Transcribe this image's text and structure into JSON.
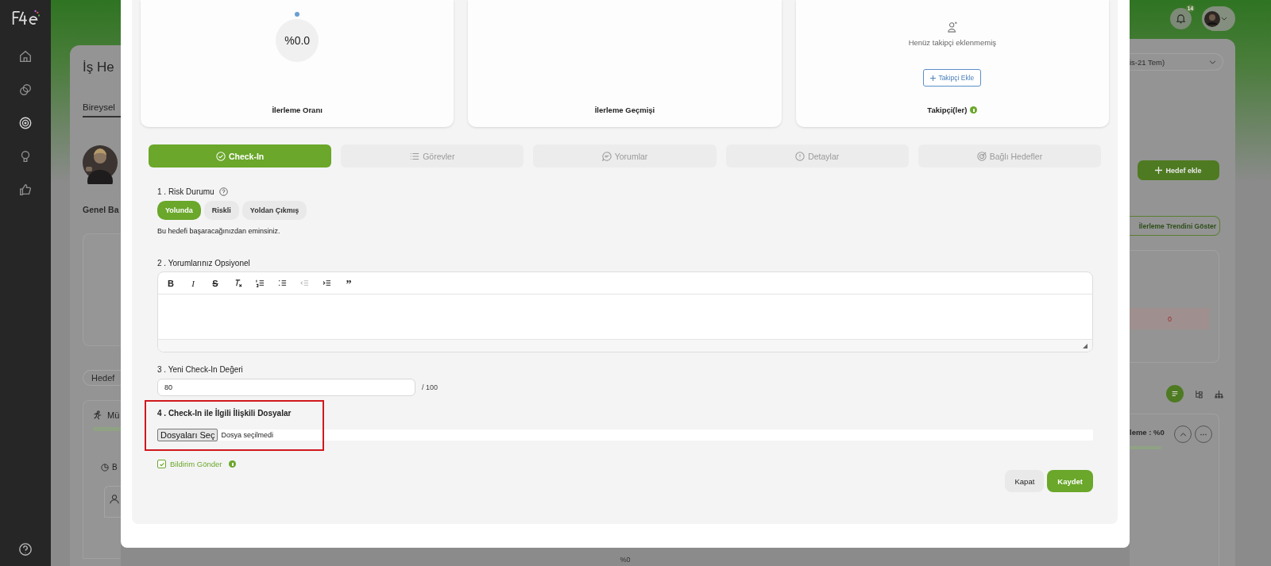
{
  "sidebar": {
    "items": [
      {
        "kind": "home",
        "selected": false
      },
      {
        "kind": "chat",
        "selected": false
      },
      {
        "kind": "target",
        "selected": true
      },
      {
        "kind": "bulb",
        "selected": false
      },
      {
        "kind": "thumb",
        "selected": false
      }
    ]
  },
  "header": {
    "notification_badge": "14"
  },
  "background_page": {
    "title": "İş He",
    "tab": "Bireysel",
    "section": "Genel Ba",
    "filter_chip": "Hedef",
    "goal_title": "Mü",
    "sub_label": "B",
    "date_range": "is-21 Tem)",
    "add_button": "Hedef ekle",
    "trend_button": "İlerleme Trendini Göster",
    "cell_value": "0",
    "goal_progress": "leme : %0",
    "footer_value": "%0"
  },
  "modal": {
    "cards": [
      {
        "kind": "progress",
        "value": "%0.0",
        "label": "İlerleme Oranı"
      },
      {
        "kind": "history",
        "label": "İlerleme Geçmişi"
      },
      {
        "kind": "followers",
        "empty_text": "Henüz takipçi eklenmemiş",
        "button": "Takipçi Ekle",
        "label": "Takipçi(ler)"
      }
    ],
    "tabs": [
      {
        "kind": "check",
        "label": "Check-In",
        "selected": true
      },
      {
        "kind": "list",
        "label": "Görevler",
        "selected": false
      },
      {
        "kind": "comment",
        "label": "Yorumlar",
        "selected": false
      },
      {
        "kind": "info",
        "label": "Detaylar",
        "selected": false
      },
      {
        "kind": "target",
        "label": "Bağlı Hedefler",
        "selected": false
      }
    ],
    "risk": {
      "label": "1 . Risk Durumu",
      "options": [
        {
          "label": "Yolunda",
          "selected": true
        },
        {
          "label": "Riskli",
          "selected": false
        },
        {
          "label": "Yoldan Çıkmış",
          "selected": false
        }
      ],
      "description": "Bu hedefi başaracağınızdan eminsiniz."
    },
    "comments": {
      "label": "2 . Yorumlarınız Opsiyonel",
      "toolbar": [
        {
          "kind": "bold",
          "glyph": "B",
          "disabled": false
        },
        {
          "kind": "italic",
          "glyph": "I",
          "disabled": false
        },
        {
          "kind": "strike",
          "glyph": "S",
          "disabled": false
        },
        {
          "kind": "clear",
          "disabled": false
        },
        {
          "kind": "ordered",
          "disabled": false
        },
        {
          "kind": "bullet",
          "disabled": false
        },
        {
          "kind": "outdent",
          "disabled": true
        },
        {
          "kind": "indent",
          "disabled": false
        },
        {
          "kind": "quote",
          "glyph": "”",
          "disabled": false
        }
      ]
    },
    "checkin": {
      "label": "3 . Yeni Check-In Değeri",
      "value": "80",
      "max": "/ 100"
    },
    "files": {
      "label": "4 . Check-In ile İlgili İlişkili Dosyalar",
      "button": "Dosyaları Seç",
      "status": "Dosya seçilmedi",
      "highlighted": true
    },
    "notify": {
      "label": "Bildirim Gönder",
      "checked": true
    },
    "buttons": [
      {
        "kind": "secondary",
        "label": "Kapat"
      },
      {
        "kind": "primary",
        "label": "Kaydet"
      }
    ]
  }
}
